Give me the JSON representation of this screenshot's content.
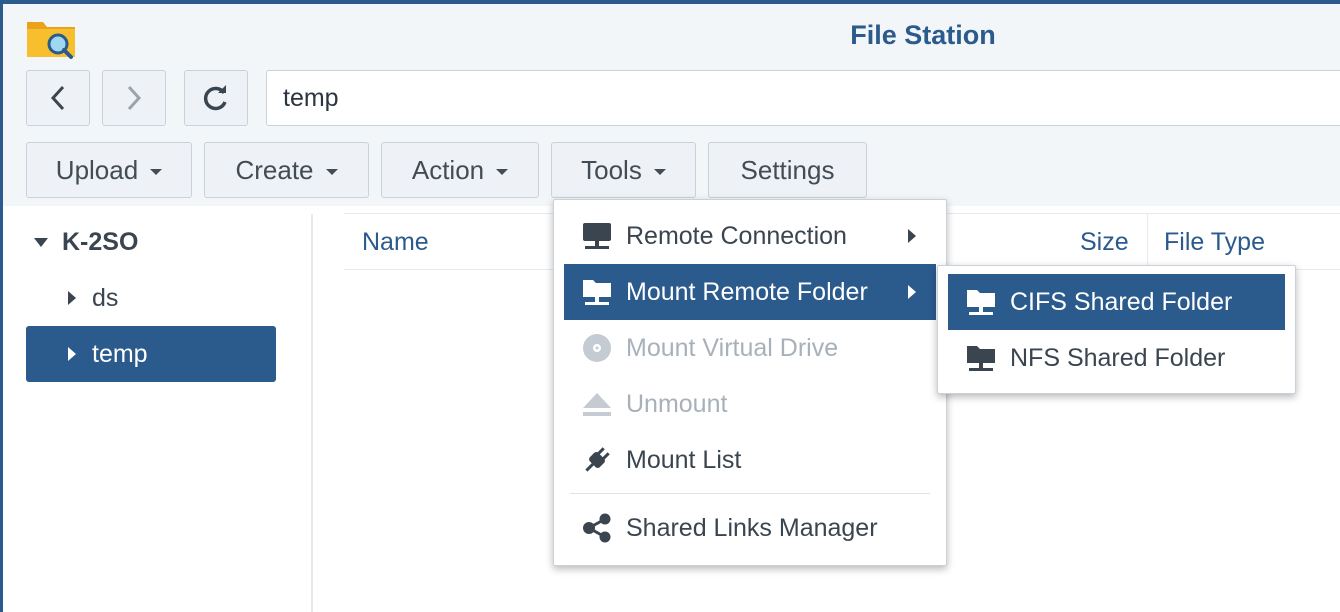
{
  "window": {
    "title": "File Station"
  },
  "nav": {
    "path_value": "temp"
  },
  "toolbar": {
    "upload": "Upload",
    "create": "Create",
    "action": "Action",
    "tools": "Tools",
    "settings": "Settings"
  },
  "sidebar": {
    "root": "K-2SO",
    "items": [
      {
        "label": "ds",
        "selected": false
      },
      {
        "label": "temp",
        "selected": true
      }
    ]
  },
  "file_list": {
    "columns": [
      "Name",
      "Size",
      "File Type"
    ]
  },
  "tools_menu": {
    "items": [
      {
        "label": "Remote Connection",
        "icon": "network-computer-icon",
        "submenu": true,
        "state": "normal"
      },
      {
        "label": "Mount Remote Folder",
        "icon": "network-folder-icon",
        "submenu": true,
        "state": "selected"
      },
      {
        "label": "Mount Virtual Drive",
        "icon": "disc-icon",
        "submenu": false,
        "state": "disabled"
      },
      {
        "label": "Unmount",
        "icon": "eject-icon",
        "submenu": false,
        "state": "disabled"
      },
      {
        "label": "Mount List",
        "icon": "plug-icon",
        "submenu": false,
        "state": "normal"
      },
      {
        "label": "Shared Links Manager",
        "icon": "share-icon",
        "submenu": false,
        "state": "normal"
      }
    ]
  },
  "mount_submenu": {
    "items": [
      {
        "label": "CIFS Shared Folder",
        "icon": "network-folder-icon",
        "state": "selected"
      },
      {
        "label": "NFS Shared Folder",
        "icon": "network-folder-icon",
        "state": "normal"
      }
    ]
  },
  "colors": {
    "accent": "#2b5a8c",
    "disabled": "#a8b1ba"
  }
}
